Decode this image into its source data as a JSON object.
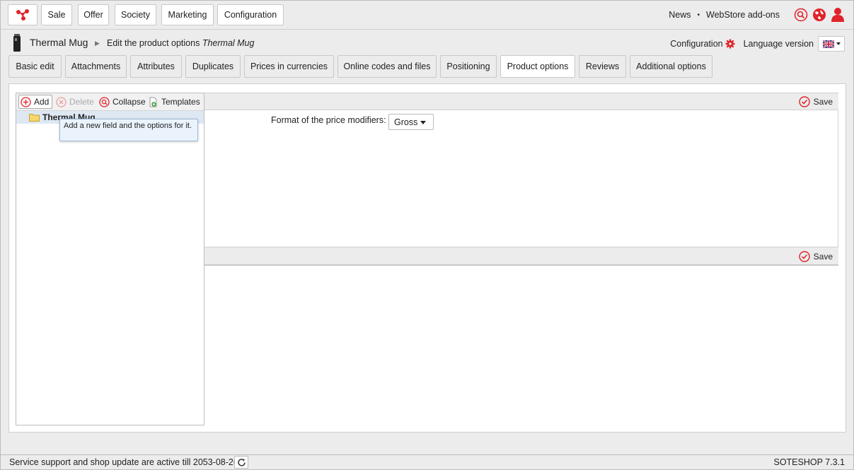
{
  "topbar": {
    "menu": [
      "Sale",
      "Offer",
      "Society",
      "Marketing",
      "Configuration"
    ],
    "right_links": [
      "News",
      "WebStore add-ons"
    ],
    "separator": "•",
    "icons": [
      "search-icon",
      "globe-icon",
      "user-icon"
    ],
    "accent_color": "#e0232a"
  },
  "titlebar": {
    "product_name": "Thermal Mug",
    "crumb_prefix": "Edit the product options",
    "crumb_product": "Thermal Mug",
    "config_label": "Configuration",
    "language_label": "Language version",
    "language_flag": "uk-flag-icon"
  },
  "tabs": [
    {
      "label": "Basic edit",
      "active": false
    },
    {
      "label": "Attachments",
      "active": false
    },
    {
      "label": "Attributes",
      "active": false
    },
    {
      "label": "Duplicates",
      "active": false
    },
    {
      "label": "Prices in currencies",
      "active": false
    },
    {
      "label": "Online codes and files",
      "active": false
    },
    {
      "label": "Positioning",
      "active": false
    },
    {
      "label": "Product options",
      "active": true
    },
    {
      "label": "Reviews",
      "active": false
    },
    {
      "label": "Additional options",
      "active": false
    }
  ],
  "tree": {
    "toolbar": {
      "add": "Add",
      "delete": "Delete",
      "collapse": "Collapse",
      "templates": "Templates"
    },
    "root_label": "Thermal Mug",
    "tooltip": "Add a new field and the options for it."
  },
  "form": {
    "save_label_top": "Save",
    "save_label_bottom": "Save",
    "price_modifier_label": "Format of the price modifiers:",
    "price_modifier_value": "Gross"
  },
  "footer": {
    "support_text": "Service support and shop update are active till 2053-08-26",
    "version": "SOTESHOP 7.3.1"
  }
}
